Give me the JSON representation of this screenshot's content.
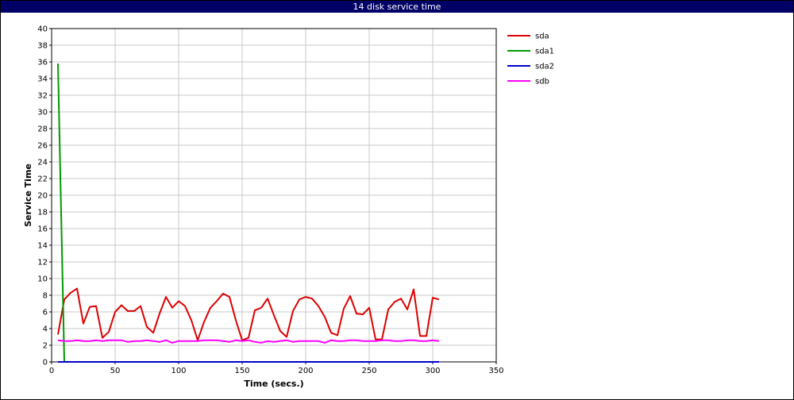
{
  "chart_data": {
    "type": "line",
    "title": "14 disk service time",
    "xlabel": "Time (secs.)",
    "ylabel": "Service Time",
    "xlim": [
      0,
      350
    ],
    "ylim": [
      0,
      40
    ],
    "xticks": [
      0,
      50,
      100,
      150,
      200,
      250,
      300,
      350
    ],
    "yticks": [
      0,
      2,
      4,
      6,
      8,
      10,
      12,
      14,
      16,
      18,
      20,
      22,
      24,
      26,
      28,
      30,
      32,
      34,
      36,
      38,
      40
    ],
    "grid": true,
    "legend_position": "right",
    "series": [
      {
        "name": "sda",
        "color": "#dd0000",
        "x": [
          5,
          10,
          15,
          20,
          25,
          30,
          35,
          40,
          45,
          50,
          55,
          60,
          65,
          70,
          75,
          80,
          85,
          90,
          95,
          100,
          105,
          110,
          115,
          120,
          125,
          130,
          135,
          140,
          145,
          150,
          155,
          160,
          165,
          170,
          175,
          180,
          185,
          190,
          195,
          200,
          205,
          210,
          215,
          220,
          225,
          230,
          235,
          240,
          245,
          250,
          255,
          260,
          265,
          270,
          275,
          280,
          285,
          290,
          295,
          300,
          305
        ],
        "y": [
          3.3,
          7.5,
          8.3,
          8.8,
          4.6,
          6.6,
          6.7,
          2.9,
          3.6,
          6.0,
          6.8,
          6.1,
          6.1,
          6.7,
          4.2,
          3.5,
          5.8,
          7.8,
          6.5,
          7.3,
          6.7,
          5.0,
          2.6,
          4.8,
          6.5,
          7.3,
          8.2,
          7.8,
          5.0,
          2.6,
          2.9,
          6.2,
          6.5,
          7.6,
          5.6,
          3.7,
          3.0,
          6.1,
          7.5,
          7.8,
          7.6,
          6.7,
          5.4,
          3.5,
          3.2,
          6.4,
          7.9,
          5.8,
          5.7,
          6.5,
          2.7,
          2.7,
          6.3,
          7.2,
          7.6,
          6.3,
          8.7,
          3.1,
          3.1,
          7.7,
          7.5
        ]
      },
      {
        "name": "sda1",
        "color": "#009900",
        "x": [
          5,
          10,
          15,
          20,
          25,
          30,
          35,
          40,
          45,
          50,
          55,
          60,
          65,
          70,
          75,
          80,
          85,
          90,
          95,
          100,
          105,
          110,
          115,
          120,
          125,
          130,
          135,
          140,
          145,
          150,
          155,
          160,
          165,
          170,
          175,
          180,
          185,
          190,
          195,
          200,
          205,
          210,
          215,
          220,
          225,
          230,
          235,
          240,
          245,
          250,
          255,
          260,
          265,
          270,
          275,
          280,
          285,
          290,
          295,
          300,
          305
        ],
        "y": [
          35.8,
          0,
          0,
          0,
          0,
          0,
          0,
          0,
          0,
          0,
          0,
          0,
          0,
          0,
          0,
          0,
          0,
          0,
          0,
          0,
          0,
          0,
          0,
          0,
          0,
          0,
          0,
          0,
          0,
          0,
          0,
          0,
          0,
          0,
          0,
          0,
          0,
          0,
          0,
          0,
          0,
          0,
          0,
          0,
          0,
          0,
          0,
          0,
          0,
          0,
          0,
          0,
          0,
          0,
          0,
          0,
          0,
          0,
          0,
          0,
          0
        ]
      },
      {
        "name": "sda2",
        "color": "#0000cc",
        "x": [
          5,
          305
        ],
        "y": [
          0,
          0
        ]
      },
      {
        "name": "sdb",
        "color": "#ff00ff",
        "x": [
          5,
          10,
          15,
          20,
          25,
          30,
          35,
          40,
          45,
          50,
          55,
          60,
          65,
          70,
          75,
          80,
          85,
          90,
          95,
          100,
          105,
          110,
          115,
          120,
          125,
          130,
          135,
          140,
          145,
          150,
          155,
          160,
          165,
          170,
          175,
          180,
          185,
          190,
          195,
          200,
          205,
          210,
          215,
          220,
          225,
          230,
          235,
          240,
          245,
          250,
          255,
          260,
          265,
          270,
          275,
          280,
          285,
          290,
          295,
          300,
          305
        ],
        "y": [
          2.6,
          2.5,
          2.5,
          2.6,
          2.5,
          2.5,
          2.6,
          2.5,
          2.6,
          2.6,
          2.6,
          2.4,
          2.5,
          2.5,
          2.6,
          2.5,
          2.4,
          2.6,
          2.3,
          2.5,
          2.5,
          2.5,
          2.5,
          2.6,
          2.6,
          2.6,
          2.5,
          2.4,
          2.6,
          2.5,
          2.6,
          2.4,
          2.3,
          2.5,
          2.4,
          2.5,
          2.6,
          2.4,
          2.5,
          2.5,
          2.5,
          2.5,
          2.3,
          2.6,
          2.5,
          2.5,
          2.6,
          2.6,
          2.5,
          2.5,
          2.5,
          2.6,
          2.6,
          2.5,
          2.5,
          2.6,
          2.6,
          2.5,
          2.5,
          2.6,
          2.5
        ]
      }
    ]
  }
}
